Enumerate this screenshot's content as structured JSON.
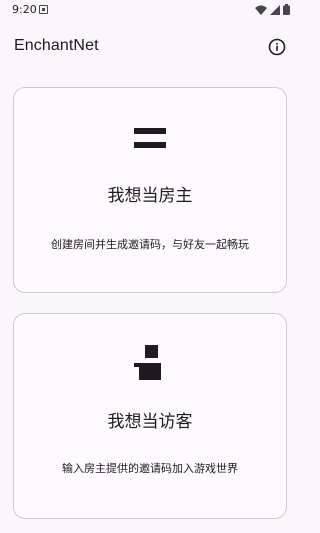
{
  "status_bar": {
    "time": "9:20",
    "icons": [
      "notification-icon",
      "wifi-icon",
      "signal-icon",
      "battery-icon"
    ]
  },
  "app_bar": {
    "title": "EnchantNet",
    "info_icon": "info-icon"
  },
  "cards": {
    "host": {
      "icon": "menu-bars-icon",
      "title": "我想当房主",
      "description": "创建房间并生成邀请码，与好友一起畅玩"
    },
    "guest": {
      "icon": "person-icon",
      "title": "我想当访客",
      "description": "输入房主提供的邀请码加入游戏世界"
    }
  },
  "colors": {
    "background": "#fbf6fb",
    "card_border": "#cfc8cf",
    "text": "#1d1b20"
  }
}
